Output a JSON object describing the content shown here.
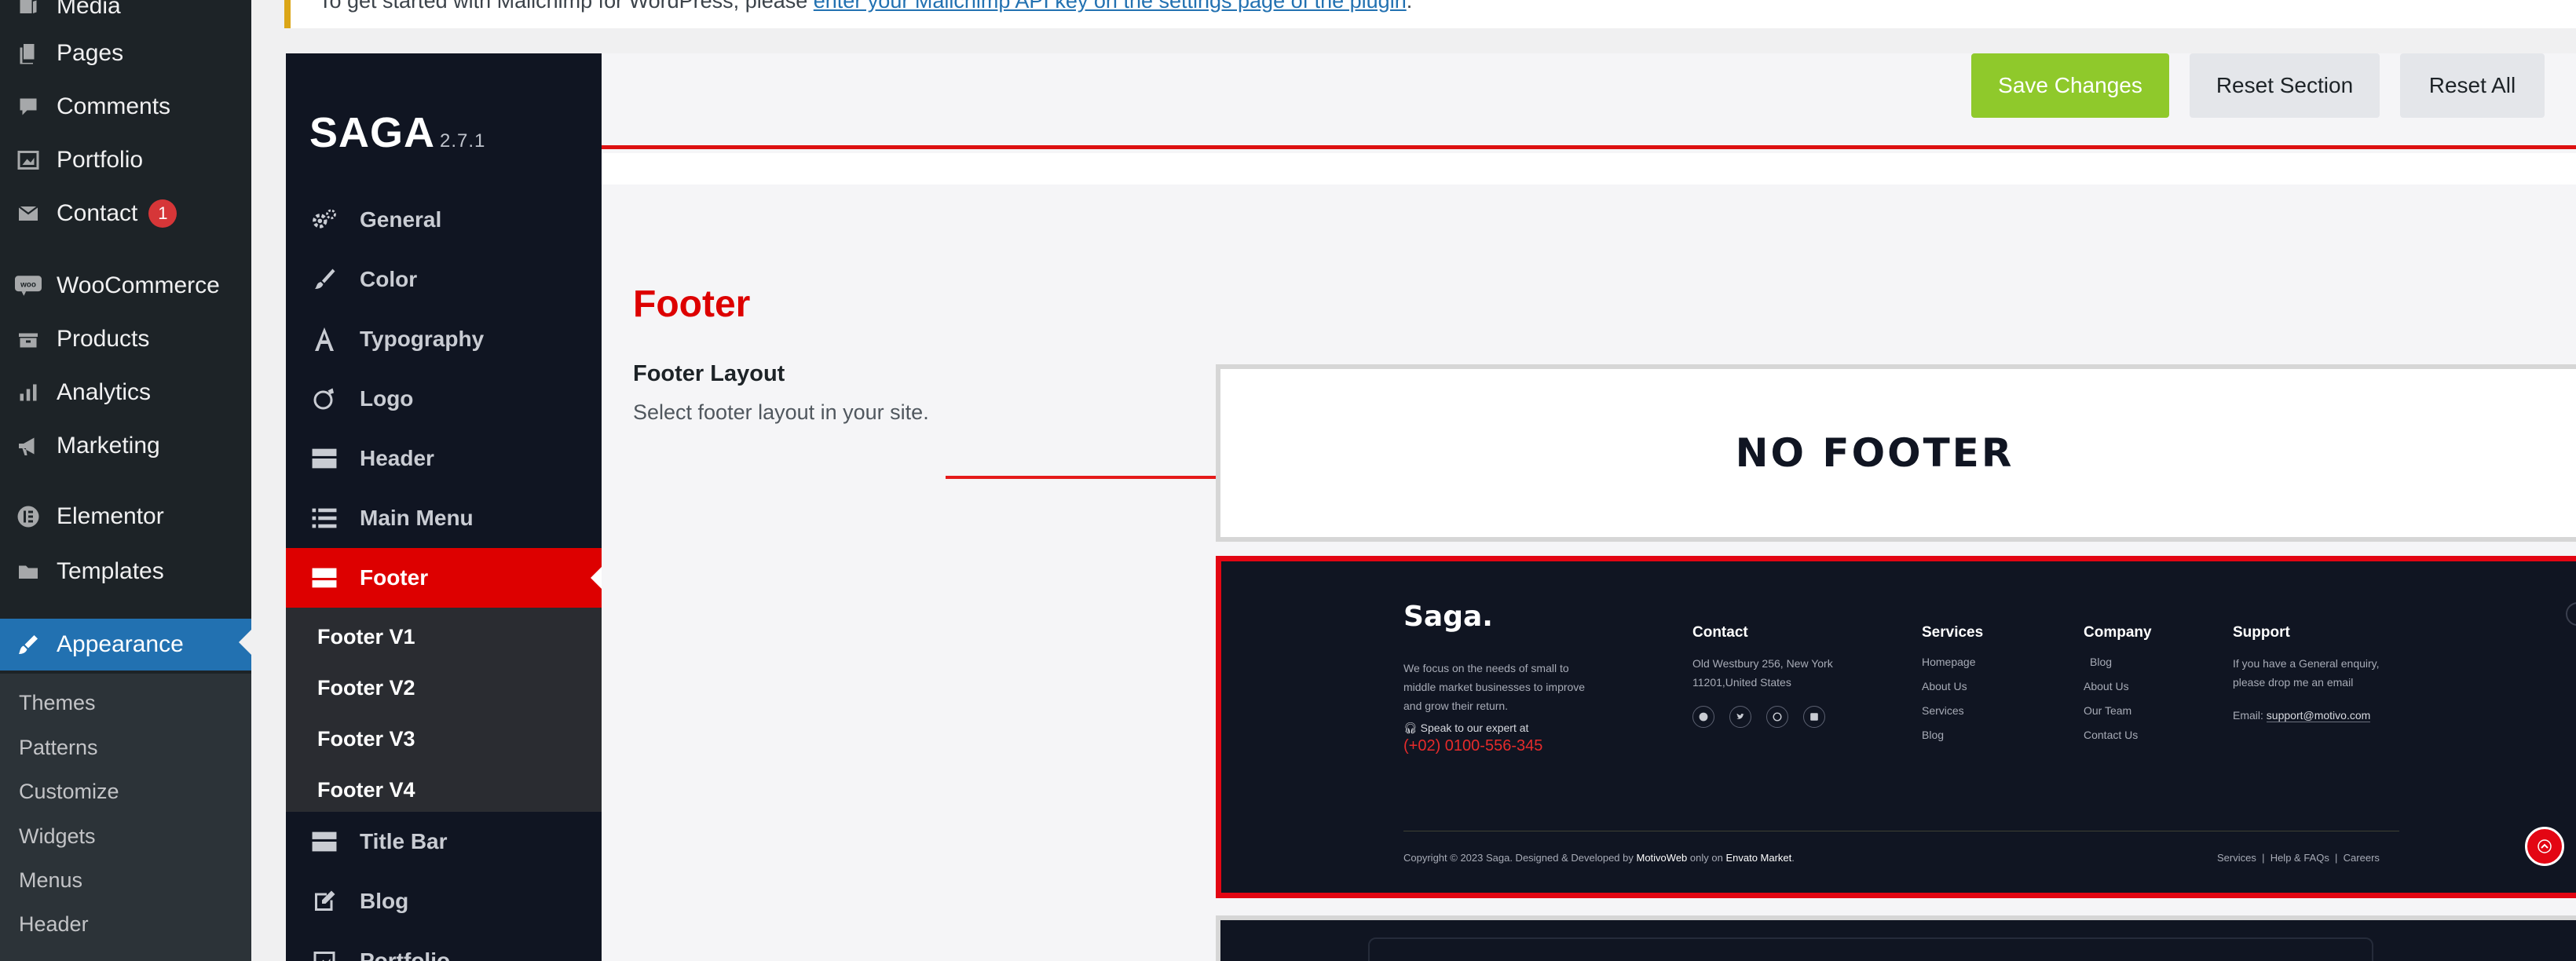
{
  "notice": {
    "text": "To get started with Mailchimp for WordPress, please ",
    "link": "enter your Mailchimp API key on the settings page of the plugin",
    "end": "."
  },
  "wp_sidebar": {
    "items": [
      {
        "label": "Media",
        "icon": "media-icon"
      },
      {
        "label": "Pages",
        "icon": "pages-icon"
      },
      {
        "label": "Comments",
        "icon": "comments-icon"
      },
      {
        "label": "Portfolio",
        "icon": "portfolio-icon"
      },
      {
        "label": "Contact",
        "icon": "mail-icon",
        "badge": "1"
      },
      {
        "label": "WooCommerce",
        "icon": "woocommerce-icon"
      },
      {
        "label": "Products",
        "icon": "products-icon"
      },
      {
        "label": "Analytics",
        "icon": "analytics-icon"
      },
      {
        "label": "Marketing",
        "icon": "marketing-icon"
      },
      {
        "label": "Elementor",
        "icon": "elementor-icon"
      },
      {
        "label": "Templates",
        "icon": "folder-icon"
      },
      {
        "label": "Appearance",
        "icon": "brush-icon",
        "active": true
      }
    ],
    "submenu": [
      "Themes",
      "Patterns",
      "Customize",
      "Widgets",
      "Menus",
      "Header"
    ]
  },
  "saga": {
    "logo": "SAGA",
    "version": "2.7.1",
    "menu": [
      {
        "label": "General",
        "icon": "gears-icon"
      },
      {
        "label": "Color",
        "icon": "brush-icon"
      },
      {
        "label": "Typography",
        "icon": "typography-icon"
      },
      {
        "label": "Logo",
        "icon": "logo-icon"
      },
      {
        "label": "Header",
        "icon": "header-icon"
      },
      {
        "label": "Main Menu",
        "icon": "list-icon"
      },
      {
        "label": "Footer",
        "icon": "footer-icon",
        "active": true
      },
      {
        "label": "Title Bar",
        "icon": "title-bar-icon"
      },
      {
        "label": "Blog",
        "icon": "edit-icon"
      },
      {
        "label": "Portfolio",
        "icon": "portfolio-icon"
      }
    ],
    "footer_submenu": [
      "Footer V1",
      "Footer V2",
      "Footer V3",
      "Footer V4"
    ]
  },
  "toolbar": {
    "save": "Save Changes",
    "reset_section": "Reset Section",
    "reset_all": "Reset All"
  },
  "section": {
    "title": "Footer",
    "field_title": "Footer Layout",
    "field_desc": "Select footer layout in your site."
  },
  "layout_options": {
    "none_label": "NO FOOTER",
    "preview": {
      "logo": "Saga.",
      "about": [
        "We focus on the needs of small to",
        "middle market businesses to improve",
        "and grow their return."
      ],
      "speak": "Speak to our expert at",
      "phone": "(+02) 0100-556-345",
      "contact_title": "Contact",
      "contact_address": [
        "Old Westbury 256, New York",
        "11201,United States"
      ],
      "services_title": "Services",
      "services_links": [
        "Homepage",
        "About Us",
        "Services",
        "Blog"
      ],
      "company_title": "Company",
      "company_links": [
        "Blog",
        "About Us",
        "Our Team",
        "Contact Us"
      ],
      "support_title": "Support",
      "support_text": [
        "If you have a General enquiry,",
        "please drop me an email"
      ],
      "support_email_label": "Email:",
      "support_email": "support@motivo.com",
      "copyright_pre": "Copyright © 2023 Saga. Designed & Developed by ",
      "copyright_brand": "MotivoWeb",
      "copyright_mid": " only on ",
      "copyright_market": "Envato Market",
      "copyright_end": ".",
      "bottom_links": [
        "Services",
        "Help & FAQs",
        "Careers"
      ]
    }
  },
  "colors": {
    "saga_red": "#dd0000",
    "save_green": "#8fc92b",
    "wp_blue": "#2271b1"
  }
}
